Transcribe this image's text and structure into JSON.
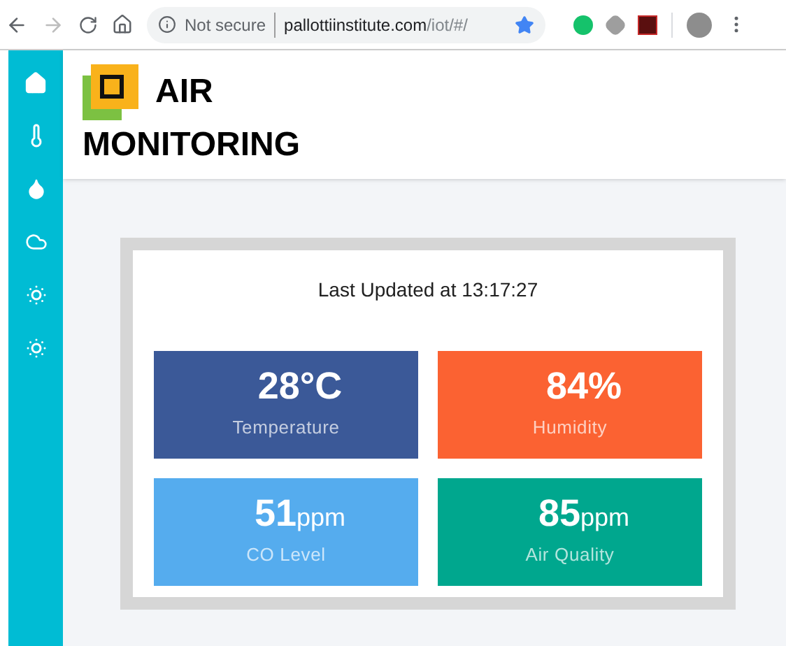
{
  "browser": {
    "security": "Not secure",
    "url_host": "pallottiinstitute.com",
    "url_path": "/iot/#/"
  },
  "header": {
    "title_line_1": "AIR",
    "title_line_2": "MONITORING"
  },
  "panel": {
    "updated": "Last Updated at 13:17:27",
    "tiles": [
      {
        "value": "28°C",
        "label": "Temperature",
        "color": "#3b5998"
      },
      {
        "value": "84%",
        "label": "Humidity",
        "color": "#fb6232"
      },
      {
        "value": "51",
        "unit": "ppm",
        "label": "CO Level",
        "color": "#55acee"
      },
      {
        "value": "85",
        "unit": "ppm",
        "label": "Air Quality",
        "color": "#00a78e"
      }
    ]
  }
}
